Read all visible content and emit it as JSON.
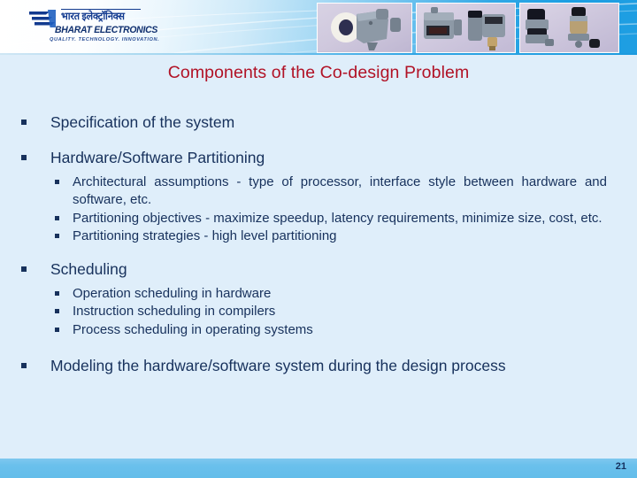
{
  "header": {
    "logo": {
      "hindi_text": "भारत इलेक्ट्रॉनिक्स",
      "name": "BHARAT ELECTRONICS",
      "tagline": "QUALITY.  TECHNOLOGY.  INNOVATION.",
      "brand_color": "#10306f"
    },
    "photos": [
      {
        "caption": "industrial-sensor-assembly"
      },
      {
        "caption": "electronic-control-modules"
      },
      {
        "caption": "valve-actuator-units"
      }
    ]
  },
  "title": "Components of the Co-design Problem",
  "title_color": "#b11226",
  "body_text_color": "#17315c",
  "background_color": "#dfeefa",
  "bullets": [
    {
      "level": 1,
      "text": "Specification of the system",
      "justify": false
    },
    {
      "level": 1,
      "text": "Hardware/Software Partitioning",
      "justify": false,
      "children": [
        {
          "level": 2,
          "text": "Architectural assumptions - type of processor, interface style between hardware and software, etc.",
          "justify": true
        },
        {
          "level": 2,
          "text": "Partitioning objectives - maximize speedup, latency requirements, minimize size, cost, etc.",
          "justify": true
        },
        {
          "level": 2,
          "text": "Partitioning strategies - high level partitioning",
          "justify": false
        }
      ]
    },
    {
      "level": 1,
      "text": "Scheduling",
      "justify": false,
      "children": [
        {
          "level": 2,
          "text": "Operation scheduling in hardware",
          "justify": false
        },
        {
          "level": 2,
          "text": "Instruction scheduling in compilers",
          "justify": false
        },
        {
          "level": 2,
          "text": "Process scheduling in operating systems",
          "justify": false
        }
      ]
    },
    {
      "level": 1,
      "text": "Modeling the hardware/software system during the design process",
      "justify": true
    }
  ],
  "footer": {
    "page_number": "21",
    "bar_color": "#6ac0ec"
  }
}
